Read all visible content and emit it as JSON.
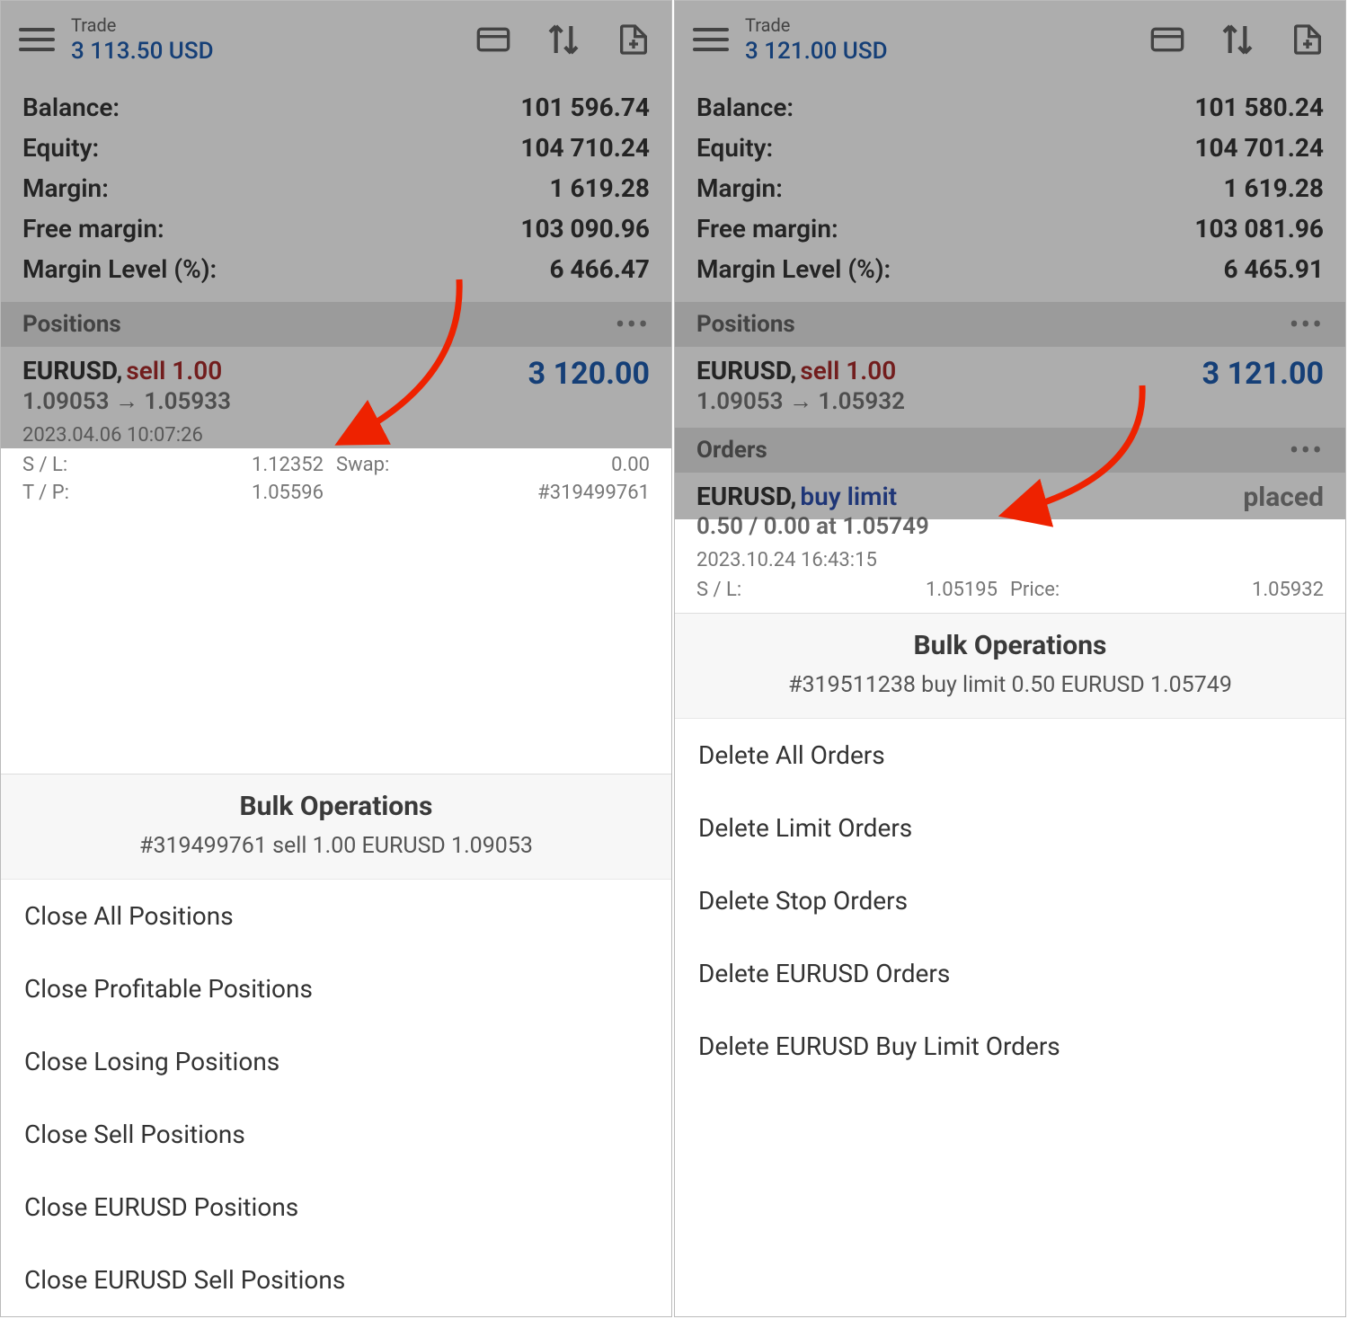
{
  "left": {
    "header": {
      "title": "Trade",
      "amount": "3 113.50 USD"
    },
    "account": [
      {
        "label": "Balance:",
        "value": "101 596.74"
      },
      {
        "label": "Equity:",
        "value": "104 710.24"
      },
      {
        "label": "Margin:",
        "value": "1 619.28"
      },
      {
        "label": "Free margin:",
        "value": "103 090.96"
      },
      {
        "label": "Margin Level (%):",
        "value": "6 466.47"
      }
    ],
    "positions_title": "Positions",
    "position": {
      "symbol": "EURUSD,",
      "side": "sell 1.00",
      "prices": "1.09053 → 1.05933",
      "profit": "3 120.00",
      "datetime": "2023.04.06 10:07:26",
      "sl_label": "S / L:",
      "sl_val": "1.12352",
      "swap_label": "Swap:",
      "swap_val": "0.00",
      "tp_label": "T / P:",
      "tp_val": "1.05596",
      "id_label": "",
      "id_val": "#319499761"
    },
    "sheet": {
      "title": "Bulk Operations",
      "subtitle": "#319499761 sell 1.00 EURUSD 1.09053",
      "items": [
        "Close All Positions",
        "Close Profitable Positions",
        "Close Losing Positions",
        "Close Sell Positions",
        "Close EURUSD Positions",
        "Close EURUSD Sell Positions"
      ]
    }
  },
  "right": {
    "header": {
      "title": "Trade",
      "amount": "3 121.00 USD"
    },
    "account": [
      {
        "label": "Balance:",
        "value": "101 580.24"
      },
      {
        "label": "Equity:",
        "value": "104 701.24"
      },
      {
        "label": "Margin:",
        "value": "1 619.28"
      },
      {
        "label": "Free margin:",
        "value": "103 081.96"
      },
      {
        "label": "Margin Level (%):",
        "value": "6 465.91"
      }
    ],
    "positions_title": "Positions",
    "position": {
      "symbol": "EURUSD,",
      "side": "sell 1.00",
      "prices": "1.09053 → 1.05932",
      "profit": "3 121.00"
    },
    "orders_title": "Orders",
    "order": {
      "symbol": "EURUSD,",
      "side": "buy limit",
      "prices": "0.50 / 0.00 at 1.05749",
      "status": "placed",
      "datetime": "2023.10.24 16:43:15",
      "sl_label": "S / L:",
      "sl_val": "1.05195",
      "price_label": "Price:",
      "price_val": "1.05932"
    },
    "sheet": {
      "title": "Bulk Operations",
      "subtitle": "#319511238 buy limit 0.50 EURUSD 1.05749",
      "items": [
        "Delete All Orders",
        "Delete Limit Orders",
        "Delete Stop Orders",
        "Delete EURUSD Orders",
        "Delete EURUSD Buy Limit Orders"
      ]
    }
  }
}
